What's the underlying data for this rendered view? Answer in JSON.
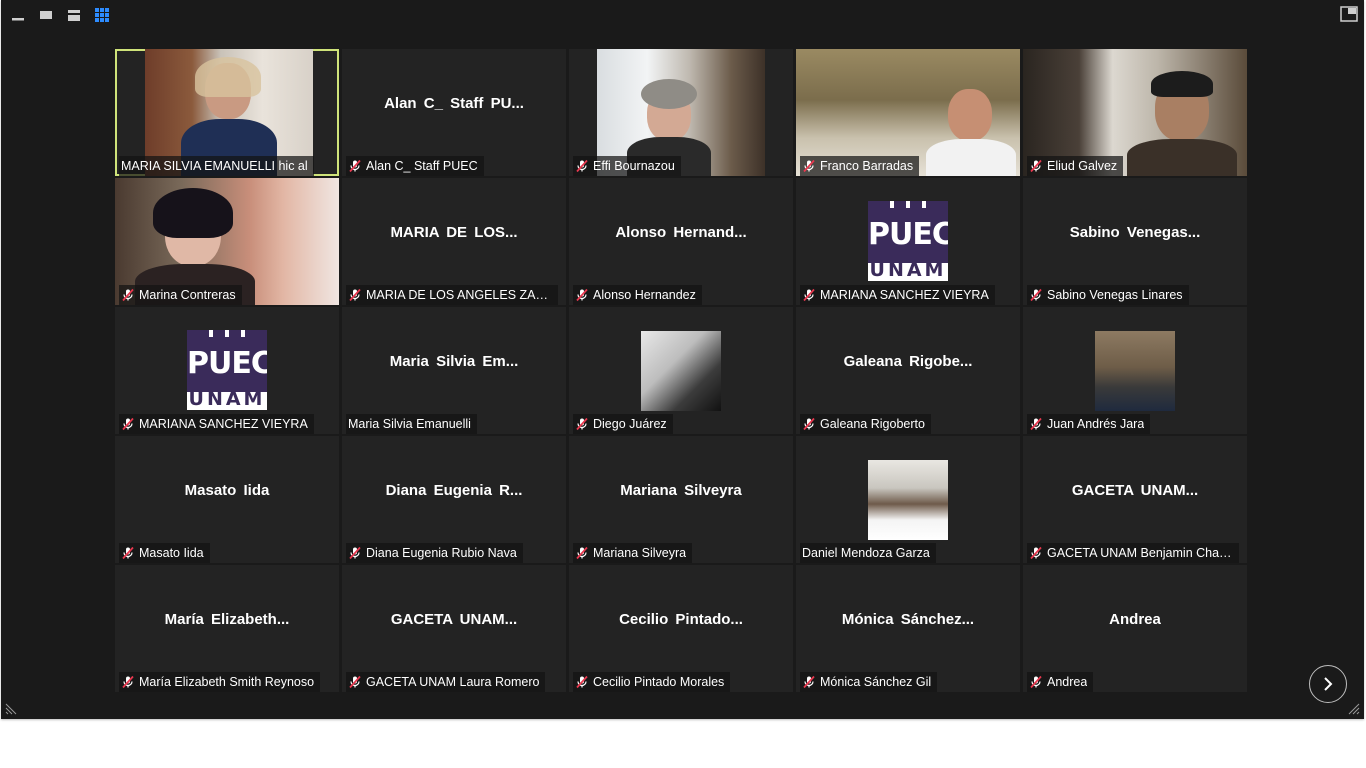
{
  "colors": {
    "background": "#1a1a1a",
    "tile": "#232323",
    "active_border": "#cfe37a",
    "mute_red": "#e8384f",
    "view_active": "#2d8cff"
  },
  "toolbar": {
    "icons": [
      "minimize-icon",
      "speaker-view-icon",
      "stacked-view-icon",
      "gallery-view-icon"
    ],
    "selected": "gallery-view-icon"
  },
  "participants": [
    {
      "display": "",
      "label": "MARIA SILVIA EMANUELLI hic al",
      "muted": false,
      "video": true
    },
    {
      "display": "Alan C_ Staff PU...",
      "label": "Alan C_ Staff PUEC",
      "muted": true,
      "video": false
    },
    {
      "display": "",
      "label": "Effi Bournazou",
      "muted": true,
      "video": true
    },
    {
      "display": "",
      "label": "Franco Barradas",
      "muted": true,
      "video": true
    },
    {
      "display": "",
      "label": "Eliud Galvez",
      "muted": true,
      "video": true
    },
    {
      "display": "",
      "label": "Marina Contreras",
      "muted": true,
      "video": true
    },
    {
      "display": "MARIA DE LOS...",
      "label": "MARIA DE LOS ANGELES ZARAT...",
      "muted": true,
      "video": false
    },
    {
      "display": "Alonso  Hernand...",
      "label": "Alonso Hernandez",
      "muted": true,
      "video": false
    },
    {
      "display": "",
      "label": "MARIANA SANCHEZ VIEYRA",
      "muted": true,
      "video": false,
      "logo": true
    },
    {
      "display": "Sabino  Venegas...",
      "label": "Sabino Venegas Linares",
      "muted": true,
      "video": false
    },
    {
      "display": "",
      "label": "MARIANA SANCHEZ VIEYRA",
      "muted": true,
      "video": false,
      "logo": true
    },
    {
      "display": "Maria  Silvia  Em...",
      "label": "Maria Silvia Emanuelli",
      "muted": false,
      "video": false
    },
    {
      "display": "",
      "label": "Diego Juárez",
      "muted": true,
      "video": false,
      "avatar": true
    },
    {
      "display": "Galeana  Rigobe...",
      "label": "Galeana Rigoberto",
      "muted": true,
      "video": false
    },
    {
      "display": "",
      "label": "Juan Andrés Jara",
      "muted": true,
      "video": false,
      "avatar": true
    },
    {
      "display": "Masato Iida",
      "label": "Masato Iida",
      "muted": true,
      "video": false
    },
    {
      "display": "Diana  Eugenia  R...",
      "label": "Diana Eugenia Rubio Nava",
      "muted": true,
      "video": false
    },
    {
      "display": "Mariana Silveyra",
      "label": "Mariana Silveyra",
      "muted": true,
      "video": false
    },
    {
      "display": "",
      "label": "Daniel Mendoza Garza",
      "muted": false,
      "video": false,
      "avatar": true
    },
    {
      "display": "GACETA  UNAM...",
      "label": "GACETA UNAM Benjamin Chaires",
      "muted": true,
      "video": false
    },
    {
      "display": "María  Elizabeth...",
      "label": "María Elizabeth Smith Reynoso",
      "muted": true,
      "video": false
    },
    {
      "display": "GACETA  UNAM...",
      "label": "GACETA UNAM Laura Romero",
      "muted": true,
      "video": false
    },
    {
      "display": "Cecilio  Pintado...",
      "label": "Cecilio Pintado Morales",
      "muted": true,
      "video": false
    },
    {
      "display": "Mónica  Sánchez...",
      "label": "Mónica Sánchez Gil",
      "muted": true,
      "video": false
    },
    {
      "display": "Andrea",
      "label": "Andrea",
      "muted": true,
      "video": false
    }
  ],
  "logo": {
    "word": "PUEC",
    "sub": "UNAM"
  }
}
